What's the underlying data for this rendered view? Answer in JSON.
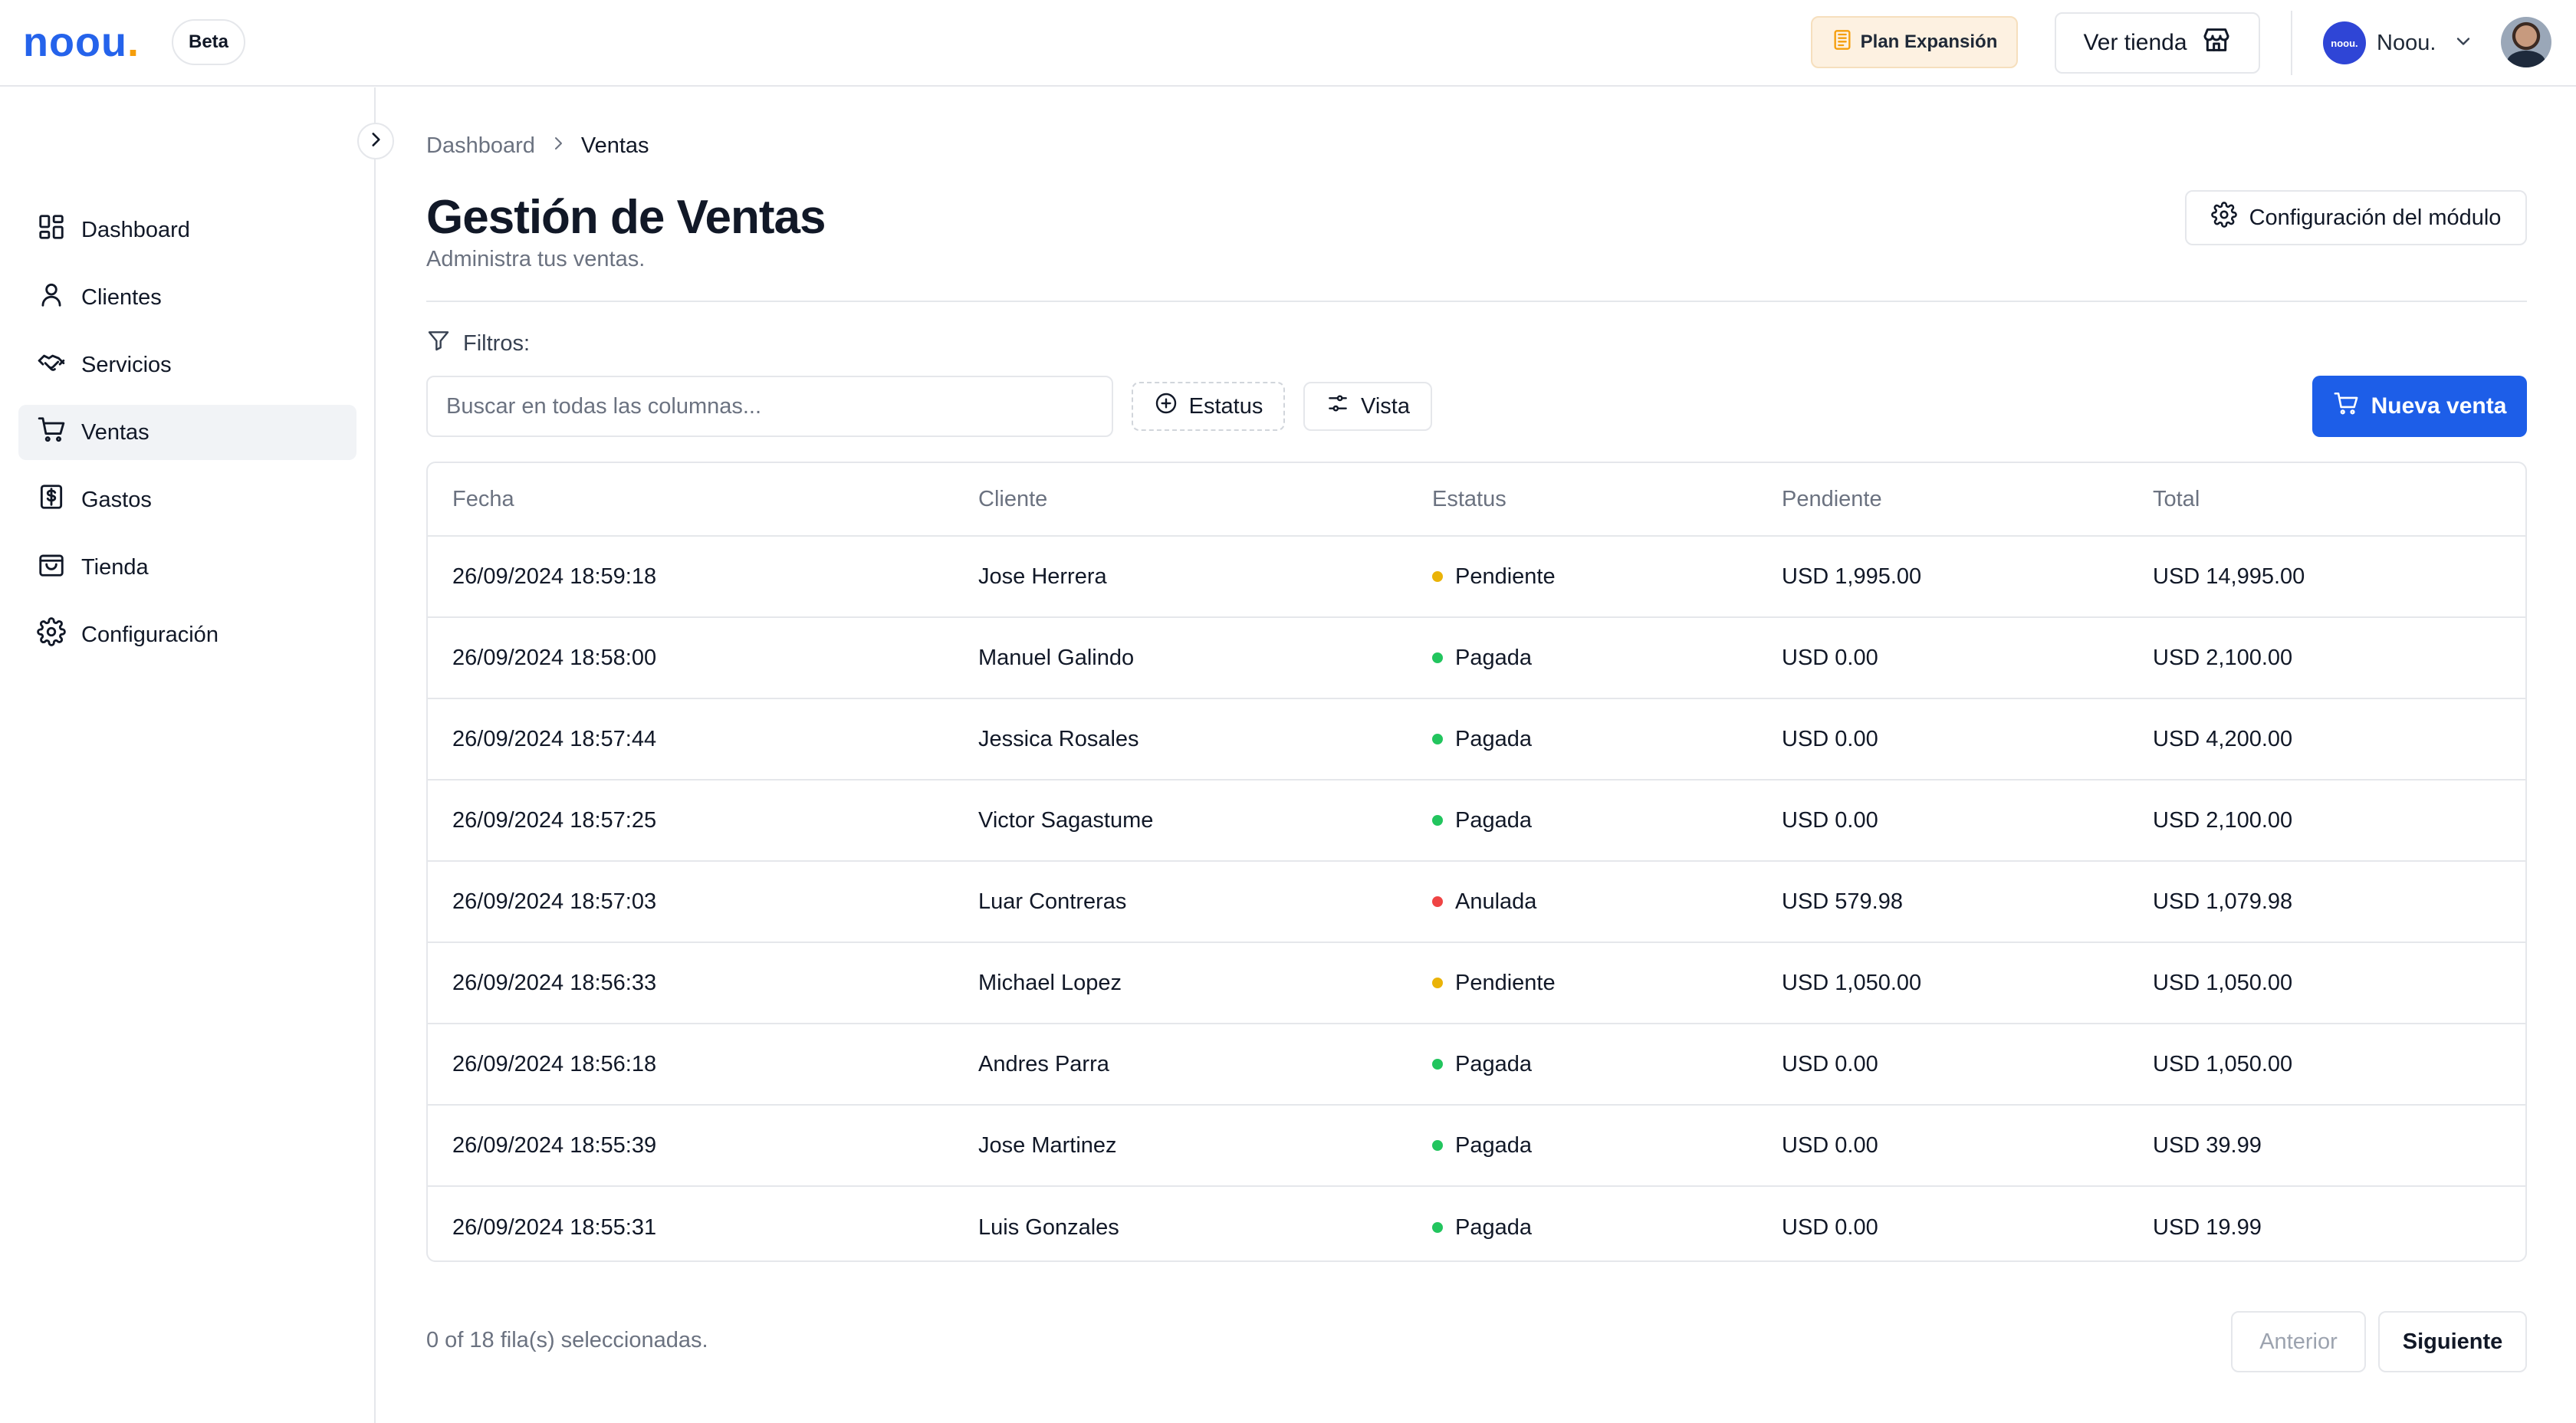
{
  "brand": {
    "logo_text": "noou",
    "logo_dot": ".",
    "badge": "Beta",
    "colors": {
      "primary": "#2563eb",
      "accent": "#f59e0b"
    }
  },
  "header": {
    "plan_label": "Plan Expansión",
    "store_label": "Ver tienda",
    "account_avatar_text": "noou.",
    "account_name": "Noou."
  },
  "sidebar": {
    "items": [
      {
        "label": "Dashboard",
        "icon": "dashboard-icon",
        "active": false
      },
      {
        "label": "Clientes",
        "icon": "user-icon",
        "active": false
      },
      {
        "label": "Servicios",
        "icon": "handshake-icon",
        "active": false
      },
      {
        "label": "Ventas",
        "icon": "cart-icon",
        "active": true
      },
      {
        "label": "Gastos",
        "icon": "dollar-receipt-icon",
        "active": false
      },
      {
        "label": "Tienda",
        "icon": "shopping-bag-icon",
        "active": false
      },
      {
        "label": "Configuración",
        "icon": "gear-icon",
        "active": false
      }
    ]
  },
  "breadcrumb": {
    "parent": "Dashboard",
    "current": "Ventas"
  },
  "page": {
    "title": "Gestión de Ventas",
    "subtitle": "Administra tus ventas.",
    "config_button": "Configuración del módulo"
  },
  "filters": {
    "label": "Filtros:",
    "search_placeholder": "Buscar en todas las columnas...",
    "search_value": "",
    "status_button": "Estatus",
    "view_button": "Vista",
    "new_sale_button": "Nueva venta"
  },
  "table": {
    "columns": [
      "Fecha",
      "Cliente",
      "Estatus",
      "Pendiente",
      "Total"
    ],
    "status_colors": {
      "Pendiente": "#eab308",
      "Pagada": "#22c55e",
      "Anulada": "#ef4444"
    },
    "rows": [
      {
        "fecha": "26/09/2024 18:59:18",
        "cliente": "Jose Herrera",
        "estatus": "Pendiente",
        "pendiente": "USD 1,995.00",
        "total": "USD 14,995.00"
      },
      {
        "fecha": "26/09/2024 18:58:00",
        "cliente": "Manuel Galindo",
        "estatus": "Pagada",
        "pendiente": "USD 0.00",
        "total": "USD 2,100.00"
      },
      {
        "fecha": "26/09/2024 18:57:44",
        "cliente": "Jessica Rosales",
        "estatus": "Pagada",
        "pendiente": "USD 0.00",
        "total": "USD 4,200.00"
      },
      {
        "fecha": "26/09/2024 18:57:25",
        "cliente": "Victor Sagastume",
        "estatus": "Pagada",
        "pendiente": "USD 0.00",
        "total": "USD 2,100.00"
      },
      {
        "fecha": "26/09/2024 18:57:03",
        "cliente": "Luar Contreras",
        "estatus": "Anulada",
        "pendiente": "USD 579.98",
        "total": "USD 1,079.98"
      },
      {
        "fecha": "26/09/2024 18:56:33",
        "cliente": "Michael Lopez",
        "estatus": "Pendiente",
        "pendiente": "USD 1,050.00",
        "total": "USD 1,050.00"
      },
      {
        "fecha": "26/09/2024 18:56:18",
        "cliente": "Andres Parra",
        "estatus": "Pagada",
        "pendiente": "USD 0.00",
        "total": "USD 1,050.00"
      },
      {
        "fecha": "26/09/2024 18:55:39",
        "cliente": "Jose Martinez",
        "estatus": "Pagada",
        "pendiente": "USD 0.00",
        "total": "USD 39.99"
      },
      {
        "fecha": "26/09/2024 18:55:31",
        "cliente": "Luis Gonzales",
        "estatus": "Pagada",
        "pendiente": "USD 0.00",
        "total": "USD 19.99"
      }
    ]
  },
  "footer": {
    "selected_text": "0 of 18 fila(s) seleccionadas.",
    "prev_label": "Anterior",
    "next_label": "Siguiente"
  }
}
